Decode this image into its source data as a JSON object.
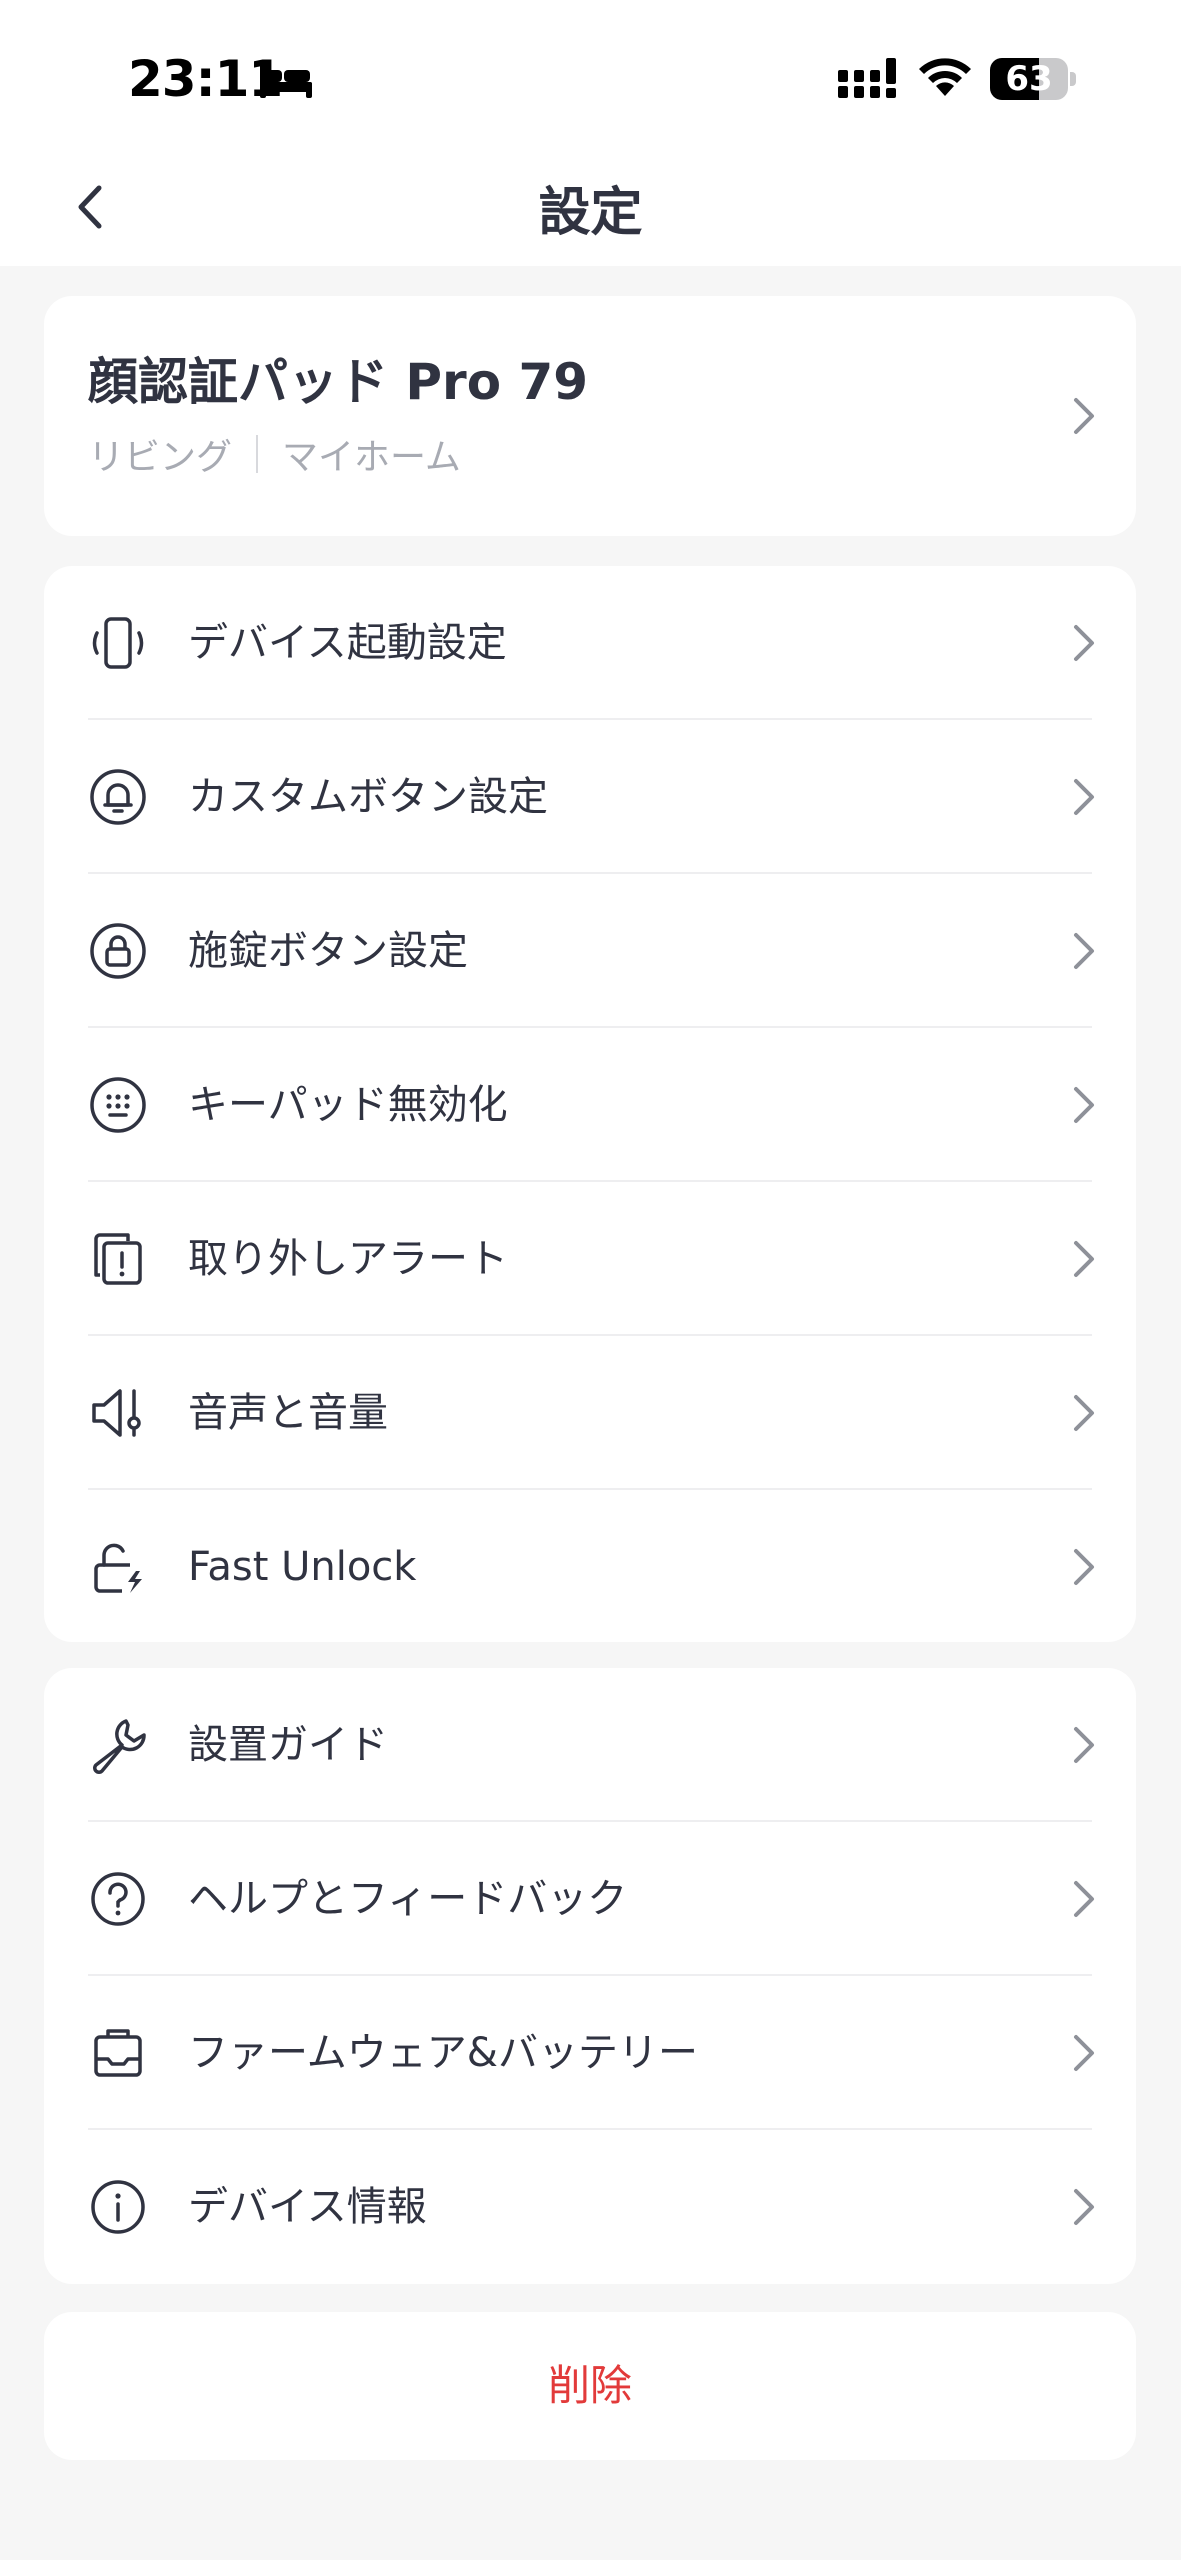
{
  "status_bar": {
    "time": "23:11",
    "battery": "63",
    "battery_level": 0.63
  },
  "header": {
    "title": "設定"
  },
  "device": {
    "name": "顔認証パッド Pro 79",
    "room": "リビング",
    "home": "マイホーム"
  },
  "settings_group_1": [
    {
      "label": "デバイス起動設定",
      "icon": "vibrate-icon"
    },
    {
      "label": "カスタムボタン設定",
      "icon": "bell-icon"
    },
    {
      "label": "施錠ボタン設定",
      "icon": "lock-icon"
    },
    {
      "label": "キーパッド無効化",
      "icon": "keypad-icon"
    },
    {
      "label": "取り外しアラート",
      "icon": "detach-alert-icon"
    },
    {
      "label": "音声と音量",
      "icon": "speaker-icon"
    },
    {
      "label": "Fast Unlock",
      "icon": "fast-unlock-icon"
    }
  ],
  "settings_group_2": [
    {
      "label": "設置ガイド",
      "icon": "wrench-icon"
    },
    {
      "label": "ヘルプとフィードバック",
      "icon": "help-icon"
    },
    {
      "label": "ファームウェア&バッテリー",
      "icon": "firmware-icon"
    },
    {
      "label": "デバイス情報",
      "icon": "info-icon"
    }
  ],
  "delete_label": "削除",
  "colors": {
    "text": "#303341",
    "subtext": "#a8abb3",
    "danger": "#e23a3a",
    "background": "#f6f6f6"
  }
}
